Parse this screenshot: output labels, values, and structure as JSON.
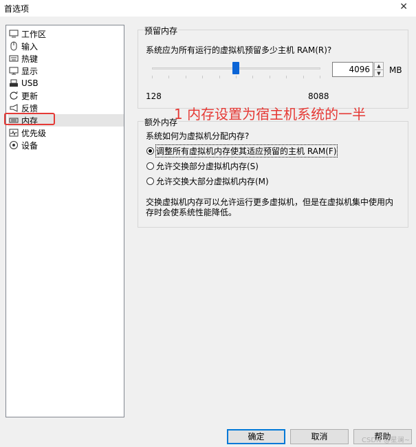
{
  "window": {
    "title": "首选项",
    "close_glyph": "✕"
  },
  "sidebar": {
    "items": [
      {
        "label": "工作区",
        "icon": "workspace-icon"
      },
      {
        "label": "输入",
        "icon": "mouse-icon"
      },
      {
        "label": "热键",
        "icon": "keyboard-icon"
      },
      {
        "label": "显示",
        "icon": "monitor-icon"
      },
      {
        "label": "USB",
        "icon": "usb-icon"
      },
      {
        "label": "更新",
        "icon": "refresh-icon"
      },
      {
        "label": "反馈",
        "icon": "megaphone-icon"
      },
      {
        "label": "内存",
        "icon": "memory-icon",
        "selected": true
      },
      {
        "label": "优先级",
        "icon": "pulse-icon"
      },
      {
        "label": "设备",
        "icon": "device-icon"
      }
    ]
  },
  "reserved_memory": {
    "group_title": "预留内存",
    "question": "系统应为所有运行的虚拟机预留多少主机 RAM(R)?",
    "value": "4096",
    "unit": "MB",
    "min_label": "128",
    "max_label": "8088",
    "slider_min": 128,
    "slider_max": 8088,
    "slider_value": 4096
  },
  "extra_memory": {
    "group_title": "额外内存",
    "question": "系统如何为虚拟机分配内存?",
    "options": [
      {
        "label": "调整所有虚拟机内存使其适应预留的主机 RAM(F)",
        "checked": true
      },
      {
        "label": "允许交换部分虚拟机内存(S)",
        "checked": false
      },
      {
        "label": "允许交换大部分虚拟机内存(M)",
        "checked": false
      }
    ],
    "description_line1": "交换虚拟机内存可以允许运行更多虚拟机，但是在虚拟机集中使用内",
    "description_line2": "存时会使系统性能降低。"
  },
  "annotation": {
    "text": "1 内存设置为宿主机系统的一半",
    "color": "#e53935"
  },
  "buttons": {
    "ok": "确定",
    "cancel": "取消",
    "help": "帮助"
  },
  "watermark": "CSDN @星澜~"
}
